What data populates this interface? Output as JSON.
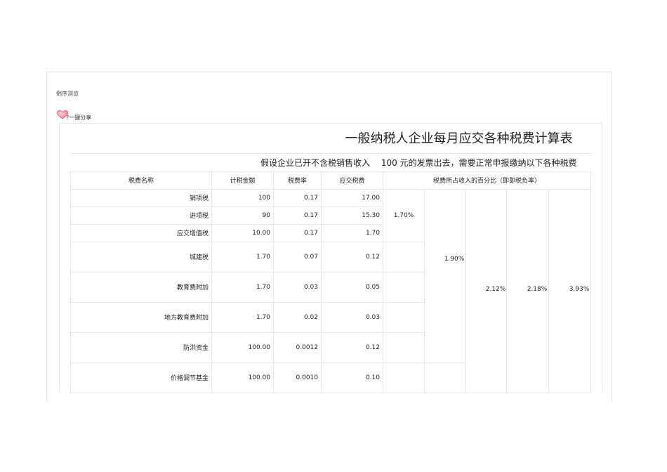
{
  "nav": {
    "browse_label": "倒序浏览"
  },
  "share": {
    "label": "?一键分享",
    "icon": "heart-icon"
  },
  "sheet": {
    "title": "一般纳税人企业每月应交各种税费计算表",
    "subtitle": "假设企业已开不含税销售收入　 100 元的发票出去，需要正常申报缴纳以下各种税费",
    "headers": {
      "name": "税费名称",
      "base": "计税金额",
      "rate": "税费率",
      "payable": "应交税费",
      "ratio": "税费所占收入的百分比（即即税负率）"
    },
    "rows": [
      {
        "name": "销项税",
        "base": "100",
        "rate": "0.17",
        "payable": "17.00"
      },
      {
        "name": "进项税",
        "base": "90",
        "rate": "0.17",
        "payable": "15.30"
      },
      {
        "name": "应交增值税",
        "base": "10.00",
        "rate": "0.17",
        "payable": "1.70"
      },
      {
        "name": "城建税",
        "base": "1.70",
        "rate": "0.07",
        "payable": "0.12"
      },
      {
        "name": "教育费附加",
        "base": "1.70",
        "rate": "0.03",
        "payable": "0.05"
      },
      {
        "name": "地方教育费附加",
        "base": "1.70",
        "rate": "0.02",
        "payable": "0.03"
      },
      {
        "name": "防洪资金",
        "base": "100.00",
        "rate": "0.0012",
        "payable": "0.12"
      },
      {
        "name": "价格调节基金",
        "base": "100.00",
        "rate": "0.0010",
        "payable": "0.10"
      }
    ],
    "ratios": {
      "vat": "1.70%",
      "city": "1.90%",
      "edu": "2.12%",
      "local_edu": "2.18%",
      "total": "3.93%"
    }
  }
}
